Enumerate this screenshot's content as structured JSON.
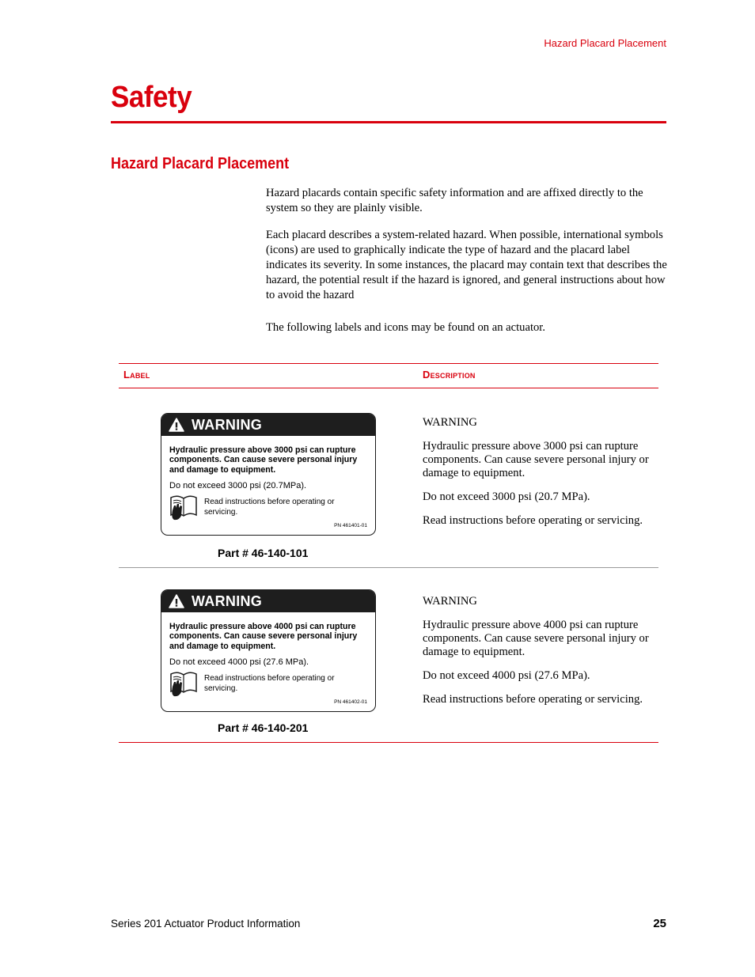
{
  "header": {
    "running_head": "Hazard Placard Placement"
  },
  "chapter": {
    "title": "Safety"
  },
  "section": {
    "title": "Hazard Placard Placement",
    "paragraphs": [
      "Hazard placards contain specific safety information and are affixed directly to the system so they are plainly visible.",
      "Each placard describes a system-related hazard. When possible, international symbols (icons) are used to graphically indicate the type of hazard and the placard label indicates its severity. In some instances, the placard may contain text that describes the hazard, the potential result if the hazard is ignored, and general instructions about how to avoid the hazard",
      "The following labels and icons may be found on an actuator."
    ]
  },
  "table": {
    "columns": [
      "Label",
      "Description"
    ],
    "rows": [
      {
        "placard": {
          "header": "WARNING",
          "hazard_text": "Hydraulic pressure above 3000 psi can rupture components.  Can cause severe personal injury and damage to equipment.",
          "limit_text": "Do not exceed 3000 psi (20.7MPa).",
          "instruction_text": "Read instructions before operating or servicing.",
          "pn": "PN 461401-01"
        },
        "part_number": "Part # 46-140-101",
        "description": {
          "heading": "WARNING",
          "hazard": "Hydraulic pressure above 3000 psi can rupture components. Can cause severe personal injury or damage to equipment.",
          "limit": "Do not exceed 3000 psi (20.7 MPa).",
          "instruction": "Read instructions before operating or servicing."
        }
      },
      {
        "placard": {
          "header": "WARNING",
          "hazard_text": "Hydraulic pressure above 4000 psi can rupture components.  Can cause severe personal injury and damage to equipment.",
          "limit_text": "Do not exceed 4000 psi (27.6 MPa).",
          "instruction_text": "Read instructions before operating or servicing.",
          "pn": "PN 461402-01"
        },
        "part_number": "Part # 46-140-201",
        "description": {
          "heading": "WARNING",
          "hazard": "Hydraulic pressure above 4000 psi can rupture components. Can cause severe personal injury or damage to equipment.",
          "limit": "Do not exceed 4000 psi (27.6 MPa).",
          "instruction": "Read instructions before operating or servicing."
        }
      }
    ]
  },
  "icons": {
    "warning": "warning-triangle-icon",
    "manual": "read-manual-icon"
  },
  "colors": {
    "accent": "#d9000d",
    "placard_header": "#1e1e1e",
    "row_divider": "#9a9a9a"
  },
  "footer": {
    "doc_title": "Series 201 Actuator Product Information",
    "page_number": "25"
  }
}
